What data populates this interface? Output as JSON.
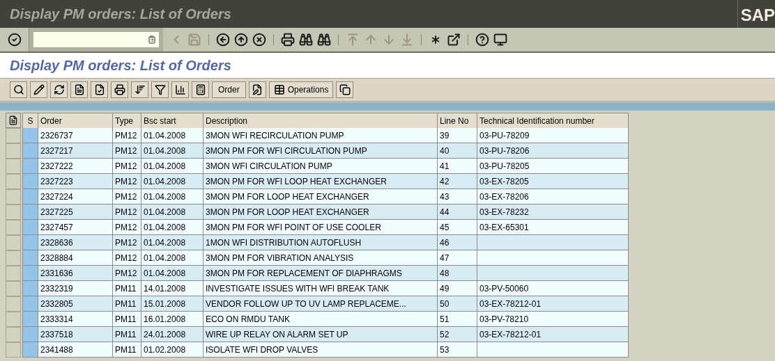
{
  "window": {
    "title": "Display PM orders: List of Orders",
    "logo": "SAP"
  },
  "system_toolbar": {
    "icons": [
      {
        "disabled": false
      },
      {
        "disabled": true
      },
      {
        "disabled": true
      },
      {
        "disabled": false
      },
      {
        "disabled": false
      },
      {
        "disabled": false
      },
      {
        "disabled": false
      },
      {
        "disabled": false
      },
      {
        "disabled": false
      },
      {
        "disabled": true
      },
      {
        "disabled": true
      },
      {
        "disabled": true
      },
      {
        "disabled": true
      },
      {
        "disabled": false
      },
      {
        "disabled": false
      },
      {
        "disabled": false
      },
      {
        "disabled": false
      }
    ]
  },
  "screen_title": "Display PM orders: List of Orders",
  "app_toolbar": [
    {
      "kind": "icon"
    },
    {
      "kind": "icon"
    },
    {
      "kind": "icon"
    },
    {
      "kind": "icon"
    },
    {
      "kind": "icon"
    },
    {
      "kind": "icon"
    },
    {
      "kind": "icon"
    },
    {
      "kind": "icon"
    },
    {
      "kind": "icon"
    },
    {
      "kind": "icon"
    },
    {
      "kind": "text",
      "label": "Order"
    },
    {
      "kind": "icon"
    },
    {
      "kind": "icon_text",
      "label": "Operations"
    },
    {
      "kind": "icon"
    }
  ],
  "table": {
    "columns": [
      "S",
      "Order",
      "Type",
      "Bsc start",
      "Description",
      "Line No",
      "Technical Identification number"
    ],
    "rows": [
      {
        "order": "2326737",
        "type": "PM12",
        "bsc_start": "01.04.2008",
        "description": "3MON WFI RECIRCULATION PUMP",
        "line_no": "39",
        "tech_id": "03-PU-78209"
      },
      {
        "order": "2327217",
        "type": "PM12",
        "bsc_start": "01.04.2008",
        "description": "3MON PM FOR WFI CIRCULATION PUMP",
        "line_no": "40",
        "tech_id": "03-PU-78206"
      },
      {
        "order": "2327222",
        "type": "PM12",
        "bsc_start": "01.04.2008",
        "description": "3MON WFI CIRCULATION PUMP",
        "line_no": "41",
        "tech_id": "03-PU-78205"
      },
      {
        "order": "2327223",
        "type": "PM12",
        "bsc_start": "01.04.2008",
        "description": "3MON PM FOR WFI LOOP HEAT EXCHANGER",
        "line_no": "42",
        "tech_id": "03-EX-78205"
      },
      {
        "order": "2327224",
        "type": "PM12",
        "bsc_start": "01.04.2008",
        "description": "3MON PM FOR LOOP HEAT EXCHANGER",
        "line_no": "43",
        "tech_id": "03-EX-78206"
      },
      {
        "order": "2327225",
        "type": "PM12",
        "bsc_start": "01.04.2008",
        "description": "3MON PM FOR LOOP HEAT EXCHANGER",
        "line_no": "44",
        "tech_id": "03-EX-78232"
      },
      {
        "order": "2327457",
        "type": "PM12",
        "bsc_start": "01.04.2008",
        "description": "3MON PM FOR WFI POINT OF USE COOLER",
        "line_no": "45",
        "tech_id": "03-EX-65301"
      },
      {
        "order": "2328636",
        "type": "PM12",
        "bsc_start": "01.04.2008",
        "description": "1MON WFI DISTRIBUTION AUTOFLUSH",
        "line_no": "46"
      },
      {
        "order": "2328884",
        "type": "PM12",
        "bsc_start": "01.04.2008",
        "description": "3MON PM FOR VIBRATION ANALYSIS",
        "line_no": "47"
      },
      {
        "order": "2331636",
        "type": "PM12",
        "bsc_start": "01.04.2008",
        "description": "3MON PM FOR REPLACEMENT OF DIAPHRAGMS",
        "line_no": "48"
      },
      {
        "order": "2332319",
        "type": "PM11",
        "bsc_start": "14.01.2008",
        "description": "INVESTIGATE ISSUES WITH WFI BREAK TANK",
        "line_no": "49",
        "tech_id": "03-PV-50060"
      },
      {
        "order": "2332805",
        "type": "PM11",
        "bsc_start": "15.01.2008",
        "description": "VENDOR FOLLOW UP TO UV LAMP REPLACEME...",
        "line_no": "50",
        "tech_id": "03-EX-78212-01"
      },
      {
        "order": "2333314",
        "type": "PM11",
        "bsc_start": "16.01.2008",
        "description": "ECO ON RMDU TANK",
        "line_no": "51",
        "tech_id": "03-PV-78210"
      },
      {
        "order": "2337518",
        "type": "PM11",
        "bsc_start": "24.01.2008",
        "description": "WIRE UP RELAY ON ALARM SET UP",
        "line_no": "52",
        "tech_id": "03-EX-78212-01"
      },
      {
        "order": "2341488",
        "type": "PM11",
        "bsc_start": "01.02.2008",
        "description": "ISOLATE WFI DROP VALVES",
        "line_no": "53"
      }
    ]
  }
}
